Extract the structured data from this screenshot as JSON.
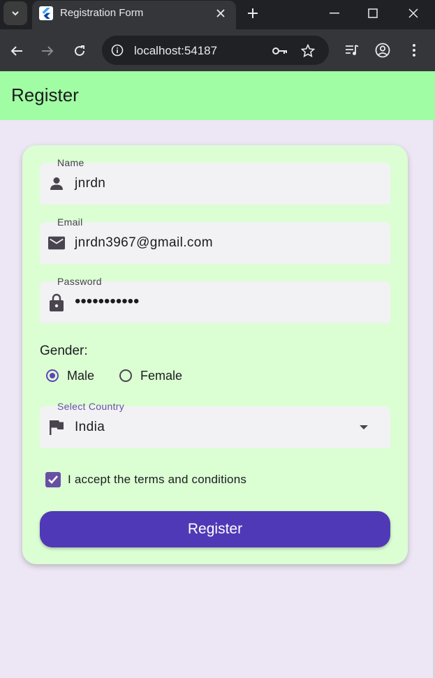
{
  "browser": {
    "tab_title": "Registration Form",
    "url": "localhost:54187"
  },
  "appbar": {
    "title": "Register"
  },
  "form": {
    "name": {
      "label": "Name",
      "value": "jnrdn"
    },
    "email": {
      "label": "Email",
      "value": "jnrdn3967@gmail.com"
    },
    "password": {
      "label": "Password",
      "value": "•••••••••••"
    },
    "gender": {
      "label": "Gender:",
      "options": [
        "Male",
        "Female"
      ],
      "selected": "Male"
    },
    "country": {
      "label": "Select Country",
      "value": "India"
    },
    "terms": {
      "label": "I accept the terms and conditions",
      "checked": true
    },
    "submit_label": "Register"
  },
  "colors": {
    "appbar": "#a1fda3",
    "card": "#dbffd3",
    "primary": "#5039b6",
    "background": "#ede6f4"
  }
}
